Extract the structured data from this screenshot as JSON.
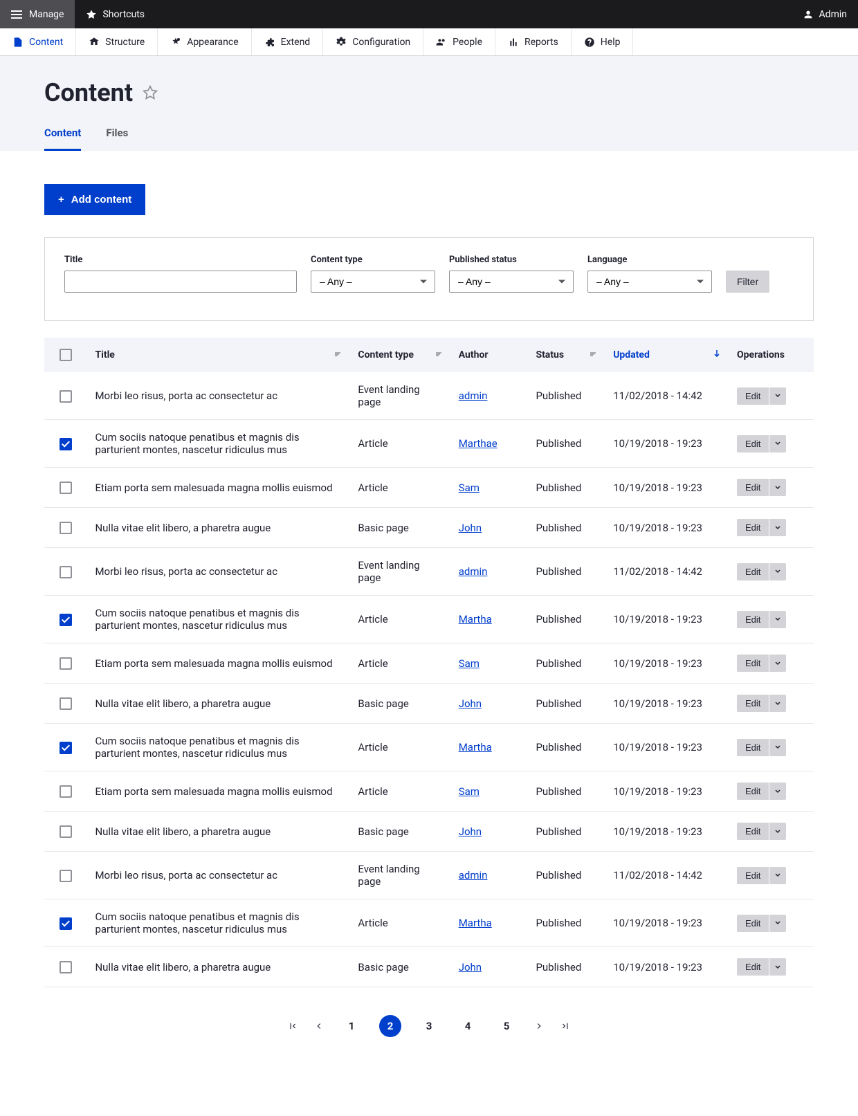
{
  "topbar": {
    "manage": "Manage",
    "shortcuts": "Shortcuts",
    "admin": "Admin"
  },
  "adminmenu": [
    {
      "label": "Content",
      "active": true
    },
    {
      "label": "Structure",
      "active": false
    },
    {
      "label": "Appearance",
      "active": false
    },
    {
      "label": "Extend",
      "active": false
    },
    {
      "label": "Configuration",
      "active": false
    },
    {
      "label": "People",
      "active": false
    },
    {
      "label": "Reports",
      "active": false
    },
    {
      "label": "Help",
      "active": false
    }
  ],
  "page": {
    "title": "Content"
  },
  "tabs": [
    {
      "label": "Content",
      "active": true
    },
    {
      "label": "Files",
      "active": false
    }
  ],
  "actions": {
    "add_content": "Add content"
  },
  "filters": {
    "title_label": "Title",
    "title_value": "",
    "content_type_label": "Content type",
    "content_type_value": "– Any –",
    "published_label": "Published status",
    "published_value": "– Any –",
    "language_label": "Language",
    "language_value": "– Any –",
    "filter_button": "Filter"
  },
  "table": {
    "headers": {
      "title": "Title",
      "content_type": "Content type",
      "author": "Author",
      "status": "Status",
      "updated": "Updated",
      "operations": "Operations"
    },
    "edit_label": "Edit",
    "rows": [
      {
        "checked": false,
        "title": "Morbi leo risus, porta ac consectetur ac",
        "type": "Event landing page",
        "author": "admin",
        "status": "Published",
        "updated": "11/02/2018 - 14:42"
      },
      {
        "checked": true,
        "title": "Cum sociis natoque penatibus et magnis dis parturient montes, nascetur ridiculus mus",
        "type": "Article",
        "author": "Marthae",
        "status": "Published",
        "updated": "10/19/2018 - 19:23"
      },
      {
        "checked": false,
        "title": "Etiam porta sem malesuada magna mollis euismod",
        "type": "Article",
        "author": "Sam",
        "status": "Published",
        "updated": "10/19/2018 - 19:23"
      },
      {
        "checked": false,
        "title": "Nulla vitae elit libero, a pharetra augue",
        "type": "Basic page",
        "author": "John",
        "status": "Published",
        "updated": "10/19/2018 - 19:23"
      },
      {
        "checked": false,
        "title": "Morbi leo risus, porta ac consectetur ac",
        "type": "Event landing page",
        "author": "admin",
        "status": "Published",
        "updated": "11/02/2018 - 14:42"
      },
      {
        "checked": true,
        "title": "Cum sociis natoque penatibus et magnis dis parturient montes, nascetur ridiculus mus",
        "type": "Article",
        "author": "Martha",
        "status": "Published",
        "updated": "10/19/2018 - 19:23"
      },
      {
        "checked": false,
        "title": "Etiam porta sem malesuada magna mollis euismod",
        "type": "Article",
        "author": "Sam",
        "status": "Published",
        "updated": "10/19/2018 - 19:23"
      },
      {
        "checked": false,
        "title": "Nulla vitae elit libero, a pharetra augue",
        "type": "Basic page",
        "author": "John",
        "status": "Published",
        "updated": "10/19/2018 - 19:23"
      },
      {
        "checked": true,
        "title": "Cum sociis natoque penatibus et magnis dis parturient montes, nascetur ridiculus mus",
        "type": "Article",
        "author": "Martha",
        "status": "Published",
        "updated": "10/19/2018 - 19:23"
      },
      {
        "checked": false,
        "title": "Etiam porta sem malesuada magna mollis euismod",
        "type": "Article",
        "author": "Sam",
        "status": "Published",
        "updated": "10/19/2018 - 19:23"
      },
      {
        "checked": false,
        "title": "Nulla vitae elit libero, a pharetra augue",
        "type": "Basic page",
        "author": "John",
        "status": "Published",
        "updated": "10/19/2018 - 19:23"
      },
      {
        "checked": false,
        "title": "Morbi leo risus, porta ac consectetur ac",
        "type": "Event landing page",
        "author": "admin",
        "status": "Published",
        "updated": "11/02/2018 - 14:42"
      },
      {
        "checked": true,
        "title": "Cum sociis natoque penatibus et magnis dis parturient montes, nascetur ridiculus mus",
        "type": "Article",
        "author": "Martha",
        "status": "Published",
        "updated": "10/19/2018 - 19:23"
      },
      {
        "checked": false,
        "title": "Nulla vitae elit libero, a pharetra augue",
        "type": "Basic page",
        "author": "John",
        "status": "Published",
        "updated": "10/19/2018 - 19:23"
      }
    ]
  },
  "pagination": {
    "pages": [
      "1",
      "2",
      "3",
      "4",
      "5"
    ],
    "current": "2"
  }
}
